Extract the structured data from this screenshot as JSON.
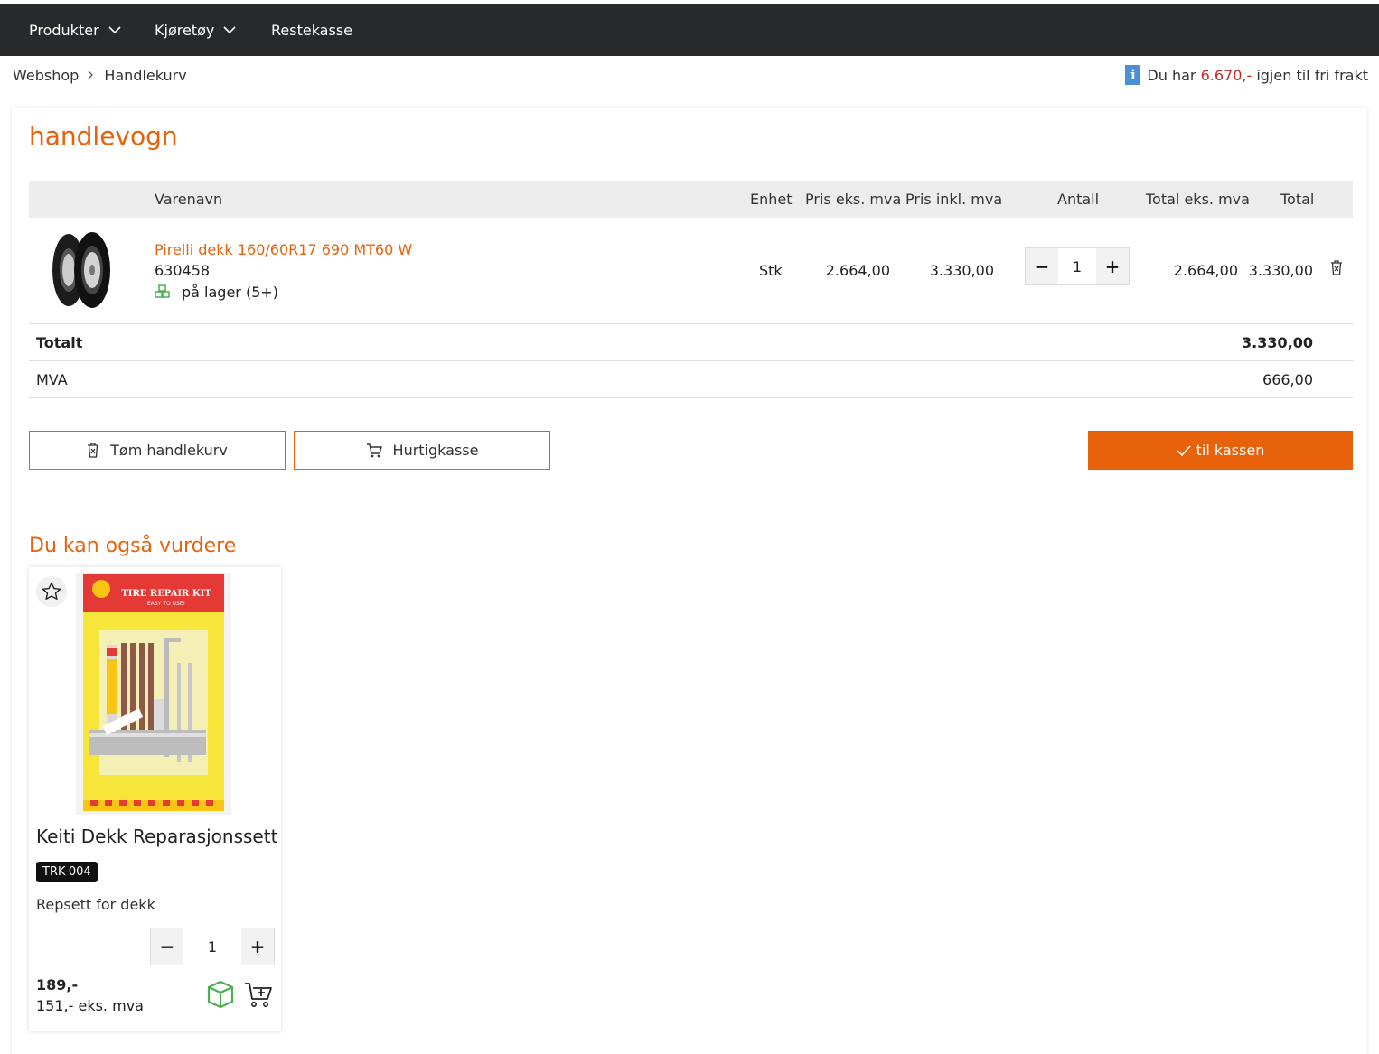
{
  "nav": {
    "items": [
      {
        "label": "Produkter",
        "dropdown": true
      },
      {
        "label": "Kjøretøy",
        "dropdown": true
      },
      {
        "label": "Restekasse",
        "dropdown": false
      }
    ]
  },
  "breadcrumb": [
    "Webshop",
    "Handlekurv"
  ],
  "freight": {
    "prefix": "Du har",
    "amount": "6.670,-",
    "suffix": "igjen til fri frakt"
  },
  "cart": {
    "title": "handlevogn",
    "columns": [
      "Varenavn",
      "Enhet",
      "Pris eks. mva",
      "Pris inkl. mva",
      "Antall",
      "Total eks. mva",
      "Total"
    ],
    "items": [
      {
        "name": "Pirelli dekk 160/60R17 690 MT60 W",
        "sku": "630458",
        "stock": "på lager (5+)",
        "unit": "Stk",
        "price_ex": "2.664,00",
        "price_inc": "3.330,00",
        "qty": "1",
        "total_ex": "2.664,00",
        "total": "3.330,00"
      }
    ],
    "summary": {
      "total_label": "Totalt",
      "total_value": "3.330,00",
      "vat_label": "MVA",
      "vat_value": "666,00"
    },
    "buttons": {
      "empty": "Tøm handlekurv",
      "quick": "Hurtigkasse",
      "checkout": "til kassen"
    }
  },
  "recommend": {
    "title": "Du kan også vurdere",
    "product": {
      "image_text": "TIRE REPAIR KIT",
      "image_subtext": "EASY TO USE!",
      "name": "Keiti Dekk Reparasjonssett",
      "sku": "TRK-004",
      "description": "Repsett for dekk",
      "qty": "1",
      "price": "189,-",
      "price_ex": "151,- eks. mva"
    }
  },
  "colors": {
    "accent": "#e8620c",
    "topbar": "#28292b",
    "stock": "#4caf50",
    "info": "#4a90d9"
  }
}
